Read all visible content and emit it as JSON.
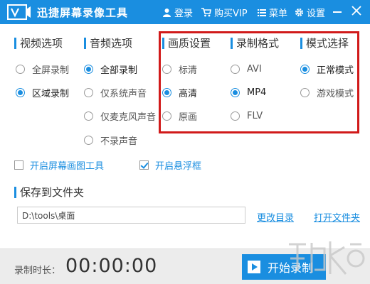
{
  "app": {
    "title": "迅捷屏幕录像工具",
    "accent": "#1a8ee0",
    "highlight_color": "#d11a1a"
  },
  "titlebar": {
    "login_label": "登录",
    "vip_label": "购买VIP",
    "menu_label": "菜单",
    "settings_label": "设置"
  },
  "sections": {
    "video": {
      "title": "视频选项",
      "options": [
        "全屏录制",
        "区域录制"
      ],
      "selected": "区域录制"
    },
    "audio": {
      "title": "音频选项",
      "options": [
        "全部录制",
        "仅系统声音",
        "仅麦克风声音",
        "不录声音"
      ],
      "selected": "全部录制"
    },
    "quality": {
      "title": "画质设置",
      "options": [
        "标清",
        "高清",
        "原画"
      ],
      "selected": "高清"
    },
    "format": {
      "title": "录制格式",
      "options": [
        "AVI",
        "MP4",
        "FLV"
      ],
      "selected": "MP4"
    },
    "mode": {
      "title": "模式选择",
      "options": [
        "正常模式",
        "游戏模式"
      ],
      "selected": "正常模式"
    }
  },
  "toggles": {
    "screen_draw_tool": {
      "label": "开启屏幕画图工具",
      "checked": false
    },
    "floating_frame": {
      "label": "开启悬浮框",
      "checked": true
    }
  },
  "save": {
    "title": "保存到文件夹",
    "path": "D:\\tools\\桌面",
    "change_dir_label": "更改目录",
    "open_folder_label": "打开文件夹"
  },
  "bottom": {
    "duration_label": "录制时长：",
    "duration_value": "00:00:00",
    "start_label": "开始录制"
  }
}
